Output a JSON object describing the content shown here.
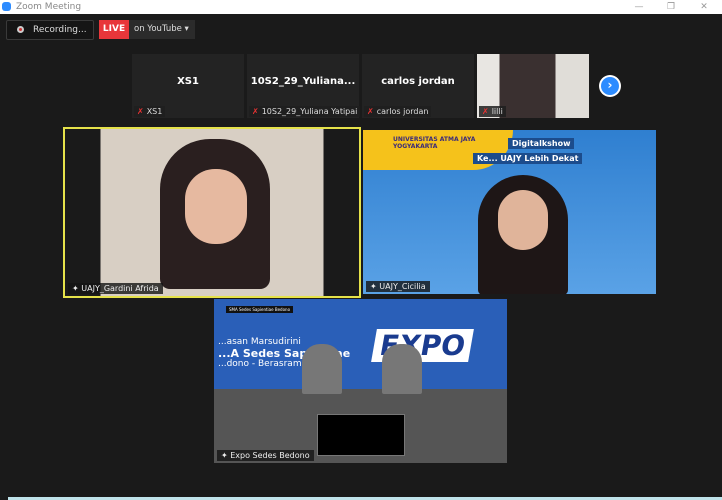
{
  "window": {
    "title": "Zoom Meeting",
    "minimize": "—",
    "restore": "❐",
    "close": "✕"
  },
  "toolbar": {
    "recording": "Recording...",
    "live": "LIVE",
    "live_target": "on YouTube ▾"
  },
  "thumbnails": [
    {
      "name": "XS1",
      "label": "XS1"
    },
    {
      "name": "10S2_29_Yuliana...",
      "label": "10S2_29_Yuliana Yatipai"
    },
    {
      "name": "carlos jordan",
      "label": "carlos jordan"
    },
    {
      "name": "",
      "label": "lilli"
    }
  ],
  "next_arrow": "›",
  "tiles": [
    {
      "label": "UAJY_Gardini Afrida"
    },
    {
      "label": "UAJY_Cicilia",
      "university": "UNIVERSITAS ATMA JAYA YOGYAKARTA",
      "show_line1": "Digitalkshow",
      "show_line2": "Ke... UAJY Lebih Dekat"
    },
    {
      "label": "Expo Sedes Bedono",
      "header": "SMA Sedes Sapientiae Bedono",
      "line1": "...asan Marsudirini",
      "line2": "...A Sedes Sapientiae",
      "line3": "...dono - Berasrama",
      "big": "EXPO"
    }
  ],
  "colors": {
    "accent": "#2d8cff",
    "live": "#e8363a",
    "active_speaker": "#e5e24a"
  }
}
